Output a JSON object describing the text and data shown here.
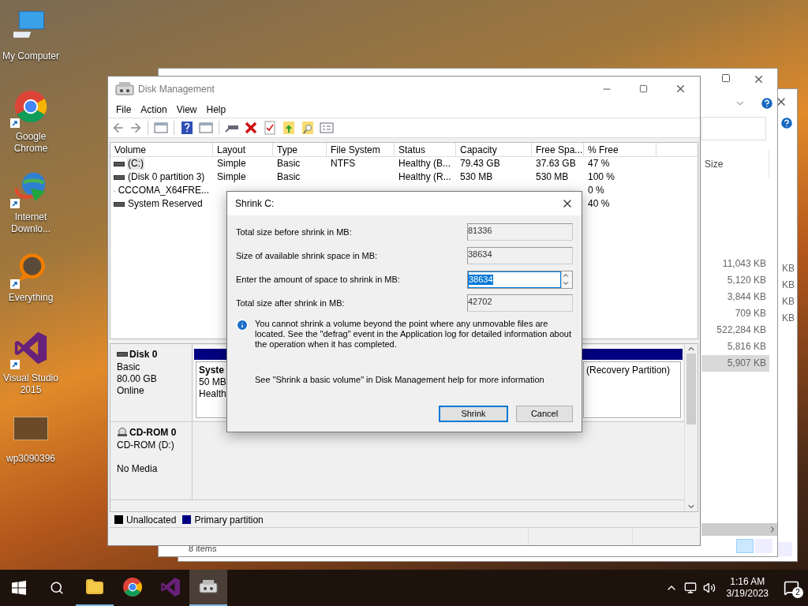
{
  "desktop_icons": [
    {
      "kind": "computer",
      "label": "My Computer",
      "shortcut": false
    },
    {
      "kind": "chrome",
      "label": "Google Chrome",
      "shortcut": true
    },
    {
      "kind": "downloader",
      "label": "Internet Downlo...",
      "shortcut": true
    },
    {
      "kind": "search",
      "label": "Everything",
      "shortcut": true
    },
    {
      "kind": "studio",
      "label": "Visual Studio 2015",
      "shortcut": true
    },
    {
      "kind": "image",
      "label": "wp3090396",
      "shortcut": false
    }
  ],
  "explorer_back": {
    "kb_fragments": [
      "KB",
      "KB",
      "KB",
      "KB"
    ]
  },
  "explorer_front": {
    "column": "Size",
    "rows": [
      {
        "size": "11,043 KB",
        "selected": false
      },
      {
        "size": "5,120 KB",
        "selected": false
      },
      {
        "size": "3,844 KB",
        "selected": false
      },
      {
        "size": "709 KB",
        "selected": false
      },
      {
        "size": "522,284 KB",
        "selected": false
      },
      {
        "size": "5,816 KB",
        "selected": false
      },
      {
        "size": "5,907 KB",
        "selected": true
      }
    ],
    "status": "8 items"
  },
  "disk_management": {
    "title": "Disk Management",
    "menu": [
      "File",
      "Action",
      "View",
      "Help"
    ],
    "columns": [
      "Volume",
      "Layout",
      "Type",
      "File System",
      "Status",
      "Capacity",
      "Free Spa...",
      "% Free"
    ],
    "rows": [
      {
        "kind": "disk",
        "cells": [
          "(C:)",
          "Simple",
          "Basic",
          "NTFS",
          "Healthy (B...",
          "79.43 GB",
          "37.63 GB",
          "47 %"
        ],
        "selected": true
      },
      {
        "kind": "disk",
        "cells": [
          "(Disk 0 partition 3)",
          "Simple",
          "Basic",
          "",
          "Healthy (R...",
          "530 MB",
          "530 MB",
          "100 %"
        ],
        "selected": false
      },
      {
        "kind": "cdrom",
        "cells": [
          "CCCOMA_X64FRE...",
          "",
          "",
          "",
          "",
          "",
          "",
          "0 %"
        ],
        "selected": false
      },
      {
        "kind": "disk",
        "cells": [
          "System Reserved",
          "",
          "",
          "",
          "",
          "",
          "",
          "40 %"
        ],
        "selected": false
      }
    ],
    "disks": [
      {
        "kind": "disk",
        "name": "Disk 0",
        "type": "Basic",
        "size": "80.00 GB",
        "status": "Online",
        "partitions": [
          {
            "name": "Syste",
            "lines": [
              "50 MB",
              "Health"
            ]
          },
          {
            "lines": [
              "(Recovery Partition)"
            ]
          }
        ]
      },
      {
        "kind": "cdrom",
        "name": "CD-ROM 0",
        "type": "CD-ROM (D:)",
        "status": "No Media"
      }
    ],
    "legend": [
      {
        "label": "Unallocated",
        "color": "#000000"
      },
      {
        "label": "Primary partition",
        "color": "#000080"
      }
    ]
  },
  "dialog": {
    "title": "Shrink C:",
    "fields": [
      {
        "kind": "readonly",
        "label": "Total size before shrink in MB:",
        "value": "81336"
      },
      {
        "kind": "readonly",
        "label": "Size of available shrink space in MB:",
        "value": "38634"
      },
      {
        "kind": "spin",
        "label": "Enter the amount of space to shrink in MB:",
        "value": "38634",
        "text_selected": true
      },
      {
        "kind": "readonly",
        "label": "Total size after shrink in MB:",
        "value": "42702"
      }
    ],
    "info": "You cannot shrink a volume beyond the point where any unmovable files are located. See the \"defrag\" event in the Application log for detailed information about the operation when it has completed.",
    "help": "See \"Shrink a basic volume\" in Disk Management help for more information",
    "buttons": [
      {
        "label": "Shrink",
        "default": true
      },
      {
        "label": "Cancel",
        "default": false
      }
    ]
  },
  "taskbar": {
    "apps": [
      {
        "kind": "explorer",
        "running": true,
        "active": false
      },
      {
        "kind": "chrome",
        "running": false,
        "active": false
      },
      {
        "kind": "studio",
        "running": false,
        "active": false
      },
      {
        "kind": "diskmgmt",
        "running": true,
        "active": true
      }
    ],
    "time": "1:16 AM",
    "date": "3/19/2023",
    "notifications": "2"
  }
}
